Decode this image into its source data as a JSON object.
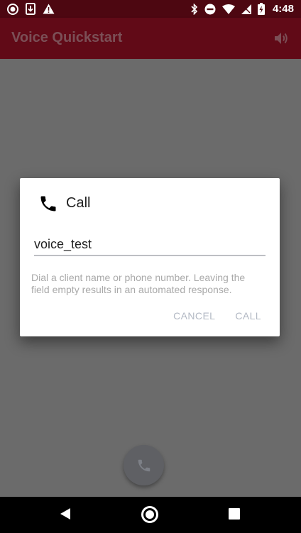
{
  "status_bar": {
    "time": "4:48",
    "left_icons": [
      "record-icon",
      "download-icon",
      "warning-icon"
    ],
    "right_icons": [
      "bluetooth-icon",
      "dnd-icon",
      "wifi-icon",
      "no-sim-icon",
      "battery-charging-icon"
    ]
  },
  "app_bar": {
    "title": "Voice Quickstart",
    "action_icon": "speaker-icon"
  },
  "dialog": {
    "title": "Call",
    "title_icon": "phone-icon",
    "input_value": "voice_test",
    "hint": "Dial a client name or phone number. Leaving the field empty results in an automated response.",
    "cancel_label": "CANCEL",
    "call_label": "CALL"
  },
  "fab": {
    "icon": "phone-icon"
  },
  "nav_bar": {
    "icons": [
      "back-icon",
      "home-icon",
      "recents-icon"
    ]
  },
  "colors": {
    "status_bar": "#4d0711",
    "app_bar": "#610a17",
    "scrim_background": "#6b6b6b",
    "dialog_button_text": "#b3b9c4",
    "fab": "#5f6064"
  }
}
